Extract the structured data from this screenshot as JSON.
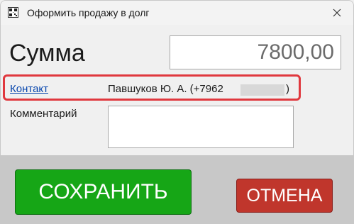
{
  "window": {
    "title": "Оформить продажу в долг"
  },
  "form": {
    "sum_label": "Сумма",
    "amount": "7800,00",
    "contact_link": "Контакт",
    "contact_name": "Павшуков Ю. А. (+7962",
    "contact_close": ")",
    "comment_label": "Комментарий",
    "comment_value": ""
  },
  "buttons": {
    "save": "СОХРАНИТЬ",
    "cancel": "ОТМЕНА"
  },
  "colors": {
    "save": "#16a616",
    "cancel": "#c0362c",
    "highlight": "#e0383e",
    "link": "#0645ad"
  },
  "icons": {
    "app": "qr-code-icon",
    "close": "close-icon"
  }
}
